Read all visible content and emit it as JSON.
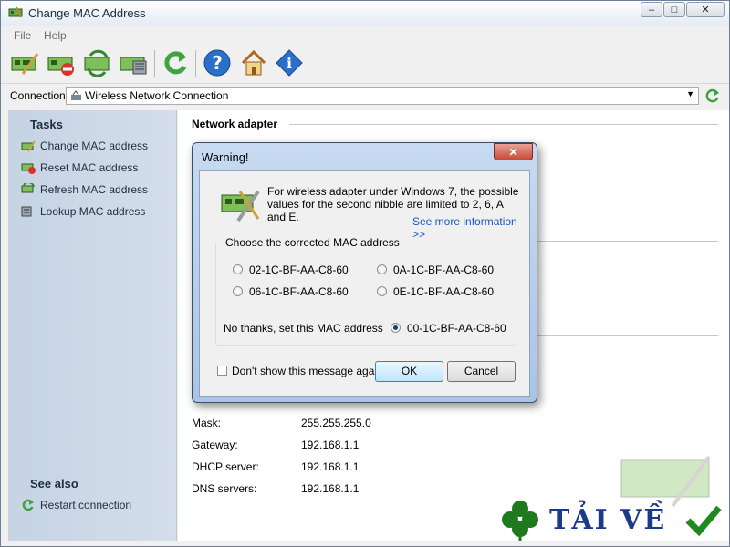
{
  "window": {
    "title": "Change MAC Address"
  },
  "menu": [
    "File",
    "Help"
  ],
  "connection": {
    "label": "Connection:",
    "value": "Wireless Network Connection"
  },
  "sidebar": {
    "tasks_title": "Tasks",
    "tasks": [
      {
        "label": "Change MAC address",
        "icon": "change-mac-icon"
      },
      {
        "label": "Reset MAC address",
        "icon": "reset-mac-icon"
      },
      {
        "label": "Refresh MAC address",
        "icon": "refresh-mac-icon"
      },
      {
        "label": "Lookup MAC address",
        "icon": "lookup-mac-icon"
      }
    ],
    "see_also_title": "See also",
    "see_also": [
      {
        "label": "Restart connection",
        "icon": "restart-icon"
      }
    ]
  },
  "main": {
    "network_adapter_title": "Network adapter",
    "rows": [
      {
        "key": "Mask:",
        "value": "255.255.255.0"
      },
      {
        "key": "Gateway:",
        "value": "192.168.1.1"
      },
      {
        "key": "DHCP server:",
        "value": "192.168.1.1"
      },
      {
        "key": "DNS servers:",
        "value": "192.168.1.1"
      }
    ]
  },
  "dialog": {
    "title": "Warning!",
    "message": "For wireless adapter under Windows 7, the possible values for the second nibble are limited to 2, 6, A and E.",
    "more_link": "See more information >>",
    "group_title": "Choose the corrected MAC address",
    "options": [
      {
        "label": "02-1C-BF-AA-C8-60",
        "selected": false
      },
      {
        "label": "0A-1C-BF-AA-C8-60",
        "selected": false
      },
      {
        "label": "06-1C-BF-AA-C8-60",
        "selected": false
      },
      {
        "label": "0E-1C-BF-AA-C8-60",
        "selected": false
      }
    ],
    "no_thanks_label": "No thanks, set this MAC address",
    "current_option": {
      "label": "00-1C-BF-AA-C8-60",
      "selected": true
    },
    "dont_show_label": "Don't show this message again",
    "dont_show_checked": false,
    "ok_label": "OK",
    "cancel_label": "Cancel"
  },
  "watermark": {
    "text": "TẢI VỀ"
  },
  "colors": {
    "sidebar": "#cdd9e7",
    "accent_link": "#1a55c4",
    "dialog_frame": "#b4cdea"
  }
}
